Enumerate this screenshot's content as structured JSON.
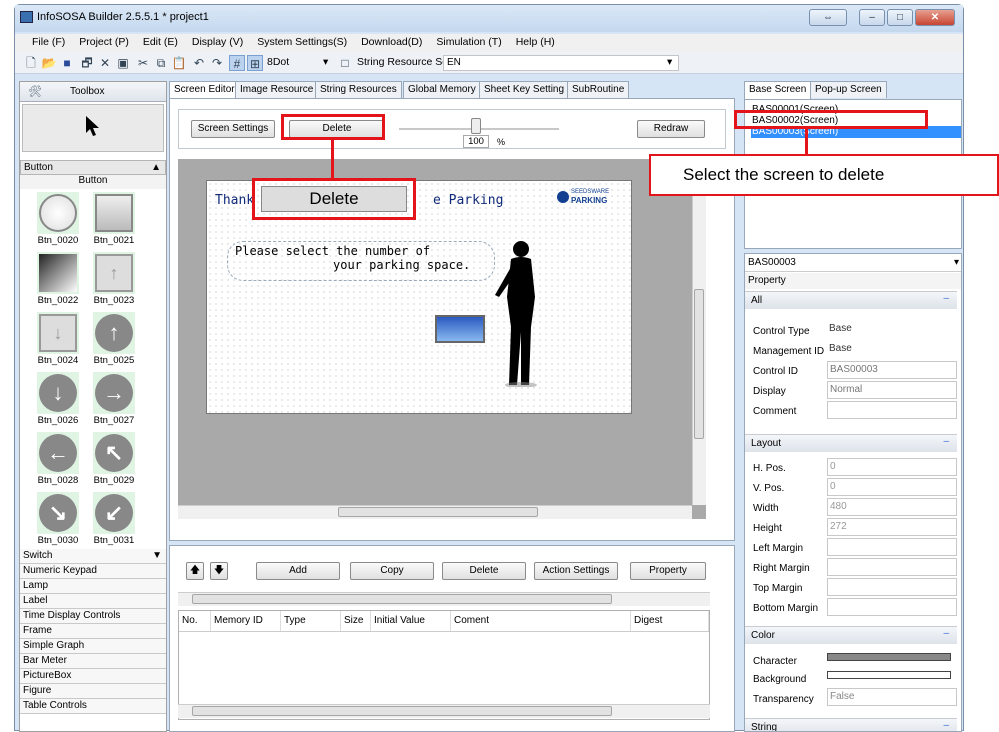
{
  "window": {
    "title": "InfoSOSA Builder 2.5.5.1 * project1"
  },
  "menu": [
    "File (F)",
    "Project (P)",
    "Edit (E)",
    "Display (V)",
    "System Settings(S)",
    "Download(D)",
    "Simulation (T)",
    "Help (H)"
  ],
  "toolbar": {
    "dot_value": "8Dot",
    "string_resource_label": "String Resource Set:",
    "string_resource_value": "EN"
  },
  "toolbox": {
    "title": "Toolbox",
    "category_button": "Button",
    "sub_button": "Button",
    "buttons": [
      "Btn_0020",
      "Btn_0021",
      "Btn_0022",
      "Btn_0023",
      "Btn_0024",
      "Btn_0025",
      "Btn_0026",
      "Btn_0027",
      "Btn_0028",
      "Btn_0029",
      "Btn_0030",
      "Btn_0031"
    ],
    "categories": [
      "Switch",
      "Numeric Keypad",
      "Lamp",
      "Label",
      "Time Display Controls",
      "Frame",
      "Simple Graph",
      "Bar Meter",
      "PictureBox",
      "Figure",
      "Table Controls"
    ]
  },
  "tabs": [
    "Screen Editor",
    "Image Resource",
    "String Resources",
    "Global Memory",
    "Sheet Key Setting",
    "SubRoutine"
  ],
  "editor": {
    "screen_settings": "Screen Settings",
    "delete": "Delete",
    "zoom": "100",
    "zoom_unit": "%",
    "redraw": "Redraw",
    "screen_text_thank": "Thank",
    "screen_text_parking": "e Parking",
    "logo_top": "SEEDSWARE",
    "logo_bottom": "PARKING",
    "screen_text_line1": "Please select the number of",
    "screen_text_line2": "your parking space.",
    "delete_popup": "Delete"
  },
  "memory": {
    "buttons": [
      "Add",
      "Copy",
      "Delete",
      "Action Settings",
      "Property"
    ],
    "up_arrow": "🡅",
    "down_arrow": "🡇",
    "columns": [
      "No.",
      "Memory ID",
      "Type",
      "Size",
      "Initial Value",
      "Coment",
      "Digest"
    ]
  },
  "screenlist": {
    "tabs": [
      "Base Screen",
      "Pop-up Screen"
    ],
    "items": [
      "BAS00001(Screen)",
      "BAS00002(Screen)",
      "BAS00003(Screen)"
    ]
  },
  "properties": {
    "selected": "BAS00003",
    "tab": "Property",
    "sec_all": "All",
    "all": [
      {
        "label": "Control Type",
        "value": "Base"
      },
      {
        "label": "Management ID",
        "value": "Base"
      },
      {
        "label": "Control ID",
        "value": "BAS00003"
      },
      {
        "label": "Display",
        "value": "Normal"
      },
      {
        "label": "Comment",
        "value": ""
      }
    ],
    "sec_layout": "Layout",
    "layout": [
      {
        "label": "H. Pos.",
        "value": "0"
      },
      {
        "label": "V. Pos.",
        "value": "0"
      },
      {
        "label": "Width",
        "value": "480"
      },
      {
        "label": "Height",
        "value": "272"
      },
      {
        "label": "Left Margin",
        "value": ""
      },
      {
        "label": "Right Margin",
        "value": ""
      },
      {
        "label": "Top Margin",
        "value": ""
      },
      {
        "label": "Bottom Margin",
        "value": ""
      }
    ],
    "sec_color": "Color",
    "color": [
      {
        "label": "Character",
        "value": ""
      },
      {
        "label": "Background",
        "value": ""
      },
      {
        "label": "Transparency",
        "value": "False"
      }
    ],
    "sec_string": "String"
  },
  "callout": "Select the screen to delete",
  "accent_color": "#e4141b"
}
